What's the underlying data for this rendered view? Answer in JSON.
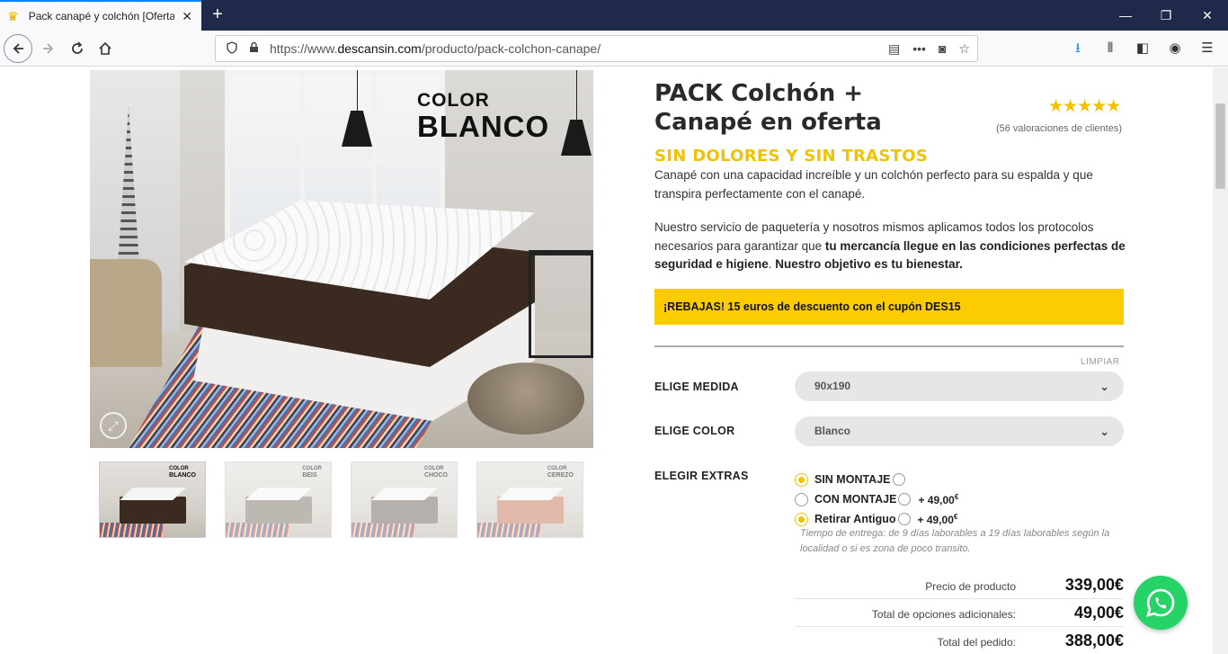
{
  "browser": {
    "tab_title": "Pack canapé y colchón [Oferta",
    "url_prefix": "https://www.",
    "url_domain": "descansin.com",
    "url_path": "/producto/pack-colchon-canape/"
  },
  "hero": {
    "color_label": "COLOR",
    "color_name": "BLANCO"
  },
  "thumbnails": [
    {
      "label_top": "COLOR",
      "label_name": "BLANCO",
      "mattress_color": "#3a2a20",
      "active": true
    },
    {
      "label_top": "COLOR",
      "label_name": "BEIS",
      "mattress_color": "#8a7f74",
      "active": false
    },
    {
      "label_top": "COLOR",
      "label_name": "CHOCO",
      "mattress_color": "#7a706a",
      "active": false
    },
    {
      "label_top": "COLOR",
      "label_name": "CEREZO",
      "mattress_color": "#c9826a",
      "active": false
    }
  ],
  "product": {
    "title": "PACK Colchón + Canapé en oferta",
    "rating_stars": 5,
    "reviews": "(56 valoraciones de clientes)",
    "subtitle": "SIN DOLORES Y SIN TRASTOS",
    "description_1": "Canapé con una capacidad increíble y un colchón perfecto para su espalda y que transpira perfectamente con el canapé.",
    "description_2a": "Nuestro servicio de paquetería y nosotros mismos aplicamos todos los protocolos necesarios para garantizar que ",
    "description_2b": "tu mercancía llegue en las condiciones perfectas de seguridad e higiene",
    "description_2c": ". ",
    "description_2d": "Nuestro objetivo es tu bienestar.",
    "promo": "¡REBAJAS! 15 euros de descuento con el cupón DES15"
  },
  "options": {
    "clear_label": "LIMPIAR",
    "size_label": "ELIGE MEDIDA",
    "size_value": "90x190",
    "color_label": "ELIGE COLOR",
    "color_value": "Blanco",
    "extras_label": "ELEGIR EXTRAS",
    "extras": [
      {
        "label": "SIN MONTAJE",
        "price": "",
        "selected": true
      },
      {
        "label": "CON MONTAJE",
        "price": "+ 49,00",
        "selected": false
      },
      {
        "label": "Retirar Antiguo",
        "price": "+ 49,00",
        "selected": true
      }
    ],
    "currency_symbol": "€",
    "delivery_note": "Tiempo de entrega: de 9 días laborables a 19 días laborables según la localidad o si es zona de poco transito."
  },
  "totals": [
    {
      "label": "Precio de producto",
      "value": "339,00€"
    },
    {
      "label": "Total de opciones adicionales:",
      "value": "49,00€"
    },
    {
      "label": "Total del pedido:",
      "value": "388,00€"
    }
  ],
  "colors": {
    "accent_yellow": "#fccc00",
    "star_yellow": "#f2c200",
    "whatsapp_green": "#25d366"
  }
}
